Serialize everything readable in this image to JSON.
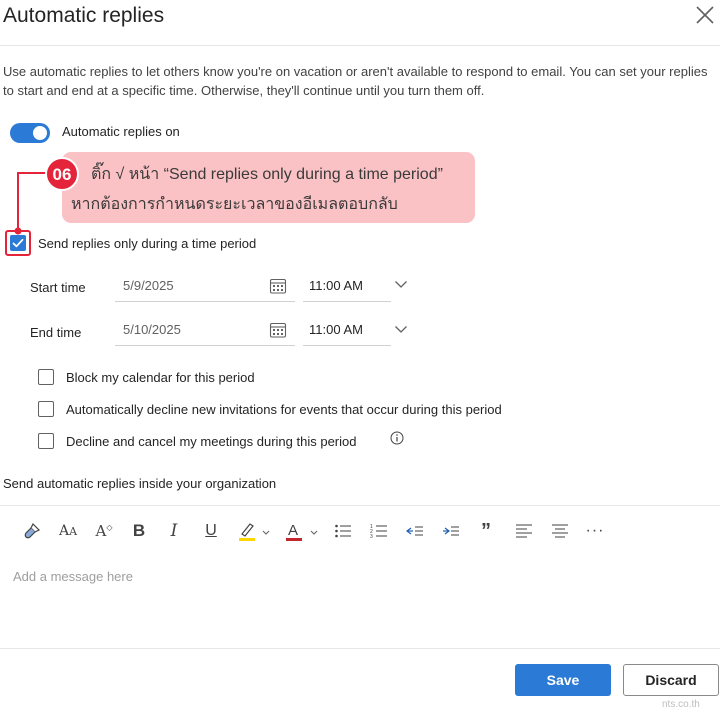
{
  "dialog": {
    "title": "Automatic replies",
    "description": "Use automatic replies to let others know you're on vacation or aren't available to respond to email. You can set your replies to start and end at a specific time. Otherwise, they'll continue until you turn them off."
  },
  "toggle": {
    "label": "Automatic replies on",
    "on": true
  },
  "callout": {
    "step": "06",
    "line1": "ติ๊ก √ หน้า “Send replies only during a time period”",
    "line2": "หากต้องการกำหนดระยะเวลาของอีเมลตอบกลับ"
  },
  "time_period": {
    "checkbox_label": "Send replies only during a time period",
    "checked": true,
    "start": {
      "label": "Start time",
      "date": "5/9/2025",
      "time": "11:00 AM"
    },
    "end": {
      "label": "End time",
      "date": "5/10/2025",
      "time": "11:00 AM"
    }
  },
  "options": [
    {
      "label": "Block my calendar for this period",
      "checked": false
    },
    {
      "label": "Automatically decline new invitations for events that occur during this period",
      "checked": false
    },
    {
      "label": "Decline and cancel my meetings during this period",
      "checked": false
    }
  ],
  "inside_org": {
    "label": "Send automatic replies inside your organization",
    "placeholder": "Add a message here"
  },
  "toolbar_icons": [
    "format-painter-icon",
    "font-size-icon",
    "text-effects-icon",
    "bold-icon",
    "italic-icon",
    "underline-icon",
    "highlight-icon",
    "font-color-icon",
    "bullets-icon",
    "numbering-icon",
    "decrease-indent-icon",
    "increase-indent-icon",
    "quote-icon",
    "align-left-icon",
    "align-center-icon",
    "more-icon"
  ],
  "colors": {
    "accent": "#2a7ad6",
    "callout_bg": "#fbc2c5",
    "step_red": "#e4243b",
    "highlight_yellow": "#ffd700",
    "font_red": "#c4262e"
  },
  "buttons": {
    "save": "Save",
    "discard": "Discard"
  },
  "watermark": "nts.co.th"
}
